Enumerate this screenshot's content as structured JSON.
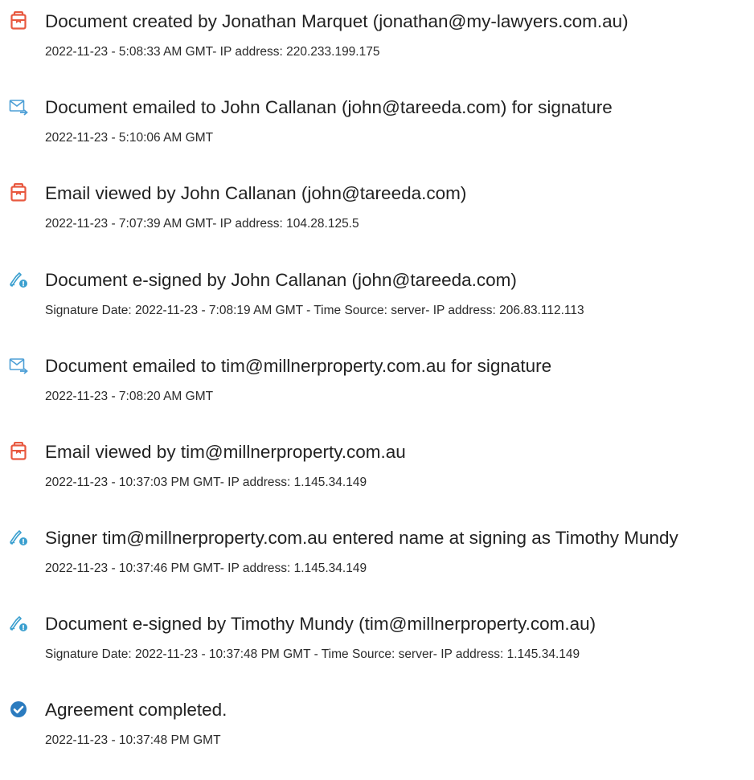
{
  "events": [
    {
      "icon": "document-icon",
      "title": "Document created by Jonathan Marquet (jonathan@my-lawyers.com.au)",
      "detail": "2022-11-23 - 5:08:33 AM GMT- IP address: 220.233.199.175"
    },
    {
      "icon": "email-sent-icon",
      "title": "Document emailed to John Callanan (john@tareeda.com) for signature",
      "detail": "2022-11-23 - 5:10:06 AM GMT"
    },
    {
      "icon": "document-icon",
      "title": "Email viewed by John Callanan (john@tareeda.com)",
      "detail": "2022-11-23 - 7:07:39 AM GMT- IP address: 104.28.125.5"
    },
    {
      "icon": "e-sign-pen-icon",
      "title": "Document e-signed by John Callanan (john@tareeda.com)",
      "detail": "Signature Date: 2022-11-23 - 7:08:19 AM GMT - Time Source: server- IP address: 206.83.112.113"
    },
    {
      "icon": "email-sent-icon",
      "title": "Document emailed to tim@millnerproperty.com.au for signature",
      "detail": "2022-11-23 - 7:08:20 AM GMT"
    },
    {
      "icon": "document-icon",
      "title": "Email viewed by tim@millnerproperty.com.au",
      "detail": "2022-11-23 - 10:37:03 PM GMT- IP address: 1.145.34.149"
    },
    {
      "icon": "e-sign-pen-icon",
      "title": "Signer tim@millnerproperty.com.au entered name at signing as Timothy Mundy",
      "detail": "2022-11-23 - 10:37:46 PM GMT- IP address: 1.145.34.149"
    },
    {
      "icon": "e-sign-pen-icon",
      "title": "Document e-signed by Timothy Mundy (tim@millnerproperty.com.au)",
      "detail": "Signature Date: 2022-11-23 - 10:37:48 PM GMT - Time Source: server- IP address: 1.145.34.149"
    },
    {
      "icon": "check-circle-icon",
      "title": "Agreement completed.",
      "detail": "2022-11-23 - 10:37:48 PM GMT"
    }
  ],
  "colors": {
    "document_icon": "#e8583f",
    "email_icon": "#4d9fd6",
    "pen_icon": "#3a9fcf",
    "check_icon": "#2b7bbf"
  }
}
